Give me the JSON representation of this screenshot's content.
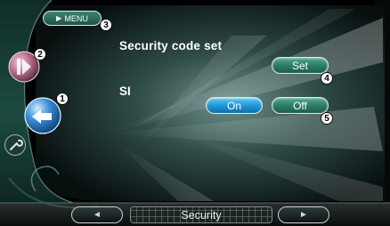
{
  "header": {
    "menu_label": "MENU"
  },
  "main": {
    "title": "Security code set",
    "set_label": "Set",
    "si_label": "SI",
    "on_label": "On",
    "off_label": "Off"
  },
  "footer": {
    "prev_symbol": "◄",
    "next_symbol": "►",
    "current_source": "Security"
  },
  "callouts": [
    "1",
    "2",
    "3",
    "4",
    "5"
  ],
  "icons": {
    "menu": "play-triangle-icon",
    "source": "media-source-icon",
    "back": "back-arrow-icon",
    "settings": "wrench-icon",
    "prev": "prev-arrow-icon",
    "next": "next-arrow-icon"
  },
  "colors": {
    "accent_green": "#2a7a63",
    "accent_blue": "#1b95d6",
    "background": "#000000"
  }
}
